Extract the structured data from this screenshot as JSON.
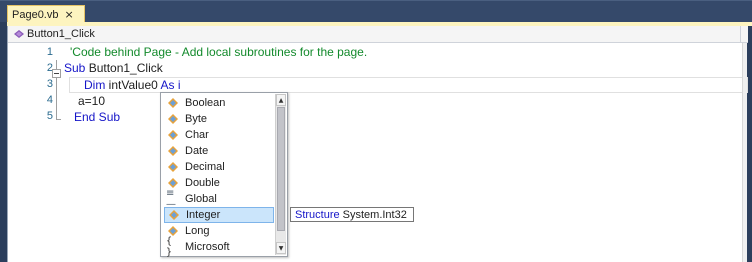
{
  "tab": {
    "title": "Page0.vb",
    "close_glyph": "×"
  },
  "navbar": {
    "member": "Button1_Click",
    "icon": "method-icon"
  },
  "editor": {
    "line_numbers": [
      "1",
      "2",
      "3",
      "4",
      "5"
    ],
    "lines": [
      {
        "comment": "'Code behind Page - Add local subroutines for the page."
      },
      {
        "kw1": "Sub",
        "text1": " Button1_Click"
      },
      {
        "kw1": "Dim",
        "text1": " intValue0 ",
        "kw2": "As",
        "text2": " i"
      },
      {
        "text1": "a=10"
      },
      {
        "kw1": "End Sub"
      }
    ]
  },
  "completion": {
    "items": [
      {
        "label": "Boolean",
        "icon": "structure-icon"
      },
      {
        "label": "Byte",
        "icon": "structure-icon"
      },
      {
        "label": "Char",
        "icon": "structure-icon"
      },
      {
        "label": "Date",
        "icon": "structure-icon"
      },
      {
        "label": "Decimal",
        "icon": "structure-icon"
      },
      {
        "label": "Double",
        "icon": "structure-icon"
      },
      {
        "label": "Global",
        "icon": "global-icon"
      },
      {
        "label": "Integer",
        "icon": "structure-icon",
        "selected": true
      },
      {
        "label": "Long",
        "icon": "structure-icon"
      },
      {
        "label": "Microsoft",
        "icon": "namespace-icon"
      }
    ]
  },
  "tooltip": {
    "kind": "Structure",
    "type": "System.Int32"
  },
  "colors": {
    "keyword": "#1515c8",
    "comment": "#138a2c",
    "selection": "#cbe5fb",
    "tab": "#fdf4bf",
    "frame": "#2b3e5c"
  }
}
